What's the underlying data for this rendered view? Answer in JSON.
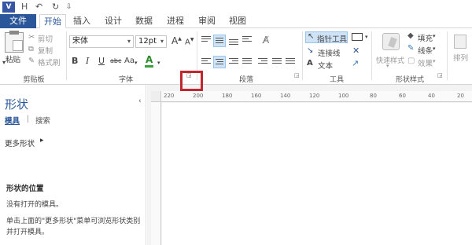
{
  "app": {
    "logo": "V",
    "qat_save": "H",
    "qat_undo": "↶",
    "qat_redo": "↻",
    "qat_more": "⇩"
  },
  "tabs": [
    "文件",
    "开始",
    "插入",
    "设计",
    "数据",
    "进程",
    "审阅",
    "视图"
  ],
  "ribbon": {
    "clipboard": {
      "paste": "粘贴",
      "cut": "剪切",
      "copy": "复制",
      "format_painter": "格式刷",
      "label": "剪贴板"
    },
    "font": {
      "font_name": "宋体",
      "font_size": "12pt",
      "grow": "A",
      "shrink": "A",
      "bold": "B",
      "italic": "I",
      "underline": "U",
      "strike": "abc",
      "aa": "Aa",
      "color_a": "A",
      "label": "字体"
    },
    "paragraph": {
      "label": "段落"
    },
    "tools": {
      "pointer": "指针工具",
      "connector": "连接线",
      "text": "文本",
      "label": "工具"
    },
    "shape_styles": {
      "quick_styles": "快速样式",
      "fill": "填充",
      "line": "线条",
      "effects": "效果",
      "label": "形状样式"
    },
    "arrange": {
      "label": "排列"
    }
  },
  "shapes_panel": {
    "title": "形状",
    "tab_stencils": "模具",
    "tab_search": "搜索",
    "more_shapes": "更多形状",
    "location_title": "形状的位置",
    "no_stencils": "没有打开的模具。",
    "hint_line1": "单击上面的\"更多形状\"菜单可浏览形状类别",
    "hint_line2": "并打开模具。"
  },
  "ruler": {
    "ticks": [
      "220",
      "200",
      "180",
      "160",
      "140",
      "120",
      "100",
      "80",
      "60",
      "40",
      "20"
    ]
  },
  "colors": {
    "file_tab": "#2b579a",
    "highlight": "#c0262d",
    "accent": "#2b579a"
  }
}
